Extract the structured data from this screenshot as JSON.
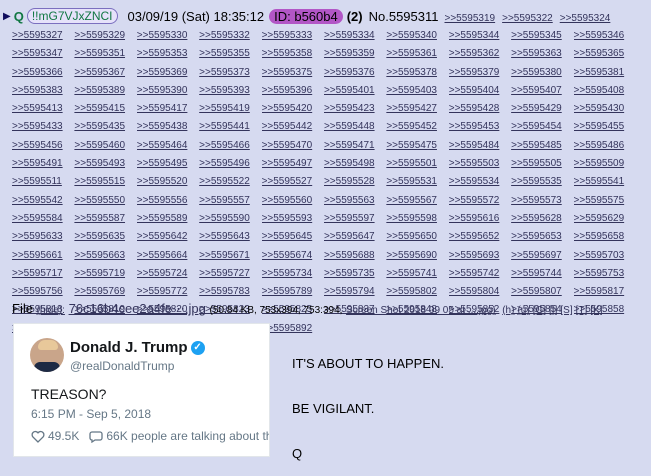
{
  "post": {
    "tripcode": "!!mG7VJxZNCI",
    "datetime": "03/09/19 (Sat) 18:35:12",
    "poster_id": "ID: b560b4",
    "post_count": "(2)",
    "post_number": "No.5595311",
    "header_replies": [
      ">>5595319",
      ">>5595322",
      ">>5595324"
    ],
    "replies": [
      ">>5595327",
      ">>5595329",
      ">>5595330",
      ">>5595332",
      ">>5595333",
      ">>5595334",
      ">>5595340",
      ">>5595344",
      ">>5595345",
      ">>5595346",
      ">>5595347",
      ">>5595351",
      ">>5595353",
      ">>5595355",
      ">>5595358",
      ">>5595359",
      ">>5595361",
      ">>5595362",
      ">>5595363",
      ">>5595365",
      ">>5595366",
      ">>5595367",
      ">>5595369",
      ">>5595373",
      ">>5595375",
      ">>5595376",
      ">>5595378",
      ">>5595379",
      ">>5595380",
      ">>5595381",
      ">>5595383",
      ">>5595389",
      ">>5595390",
      ">>5595393",
      ">>5595396",
      ">>5595401",
      ">>5595403",
      ">>5595404",
      ">>5595407",
      ">>5595408",
      ">>5595413",
      ">>5595415",
      ">>5595417",
      ">>5595419",
      ">>5595420",
      ">>5595423",
      ">>5595427",
      ">>5595428",
      ">>5595429",
      ">>5595430",
      ">>5595433",
      ">>5595435",
      ">>5595438",
      ">>5595441",
      ">>5595442",
      ">>5595448",
      ">>5595452",
      ">>5595453",
      ">>5595454",
      ">>5595455",
      ">>5595456",
      ">>5595460",
      ">>5595464",
      ">>5595466",
      ">>5595470",
      ">>5595471",
      ">>5595475",
      ">>5595484",
      ">>5595485",
      ">>5595486",
      ">>5595491",
      ">>5595493",
      ">>5595495",
      ">>5595496",
      ">>5595497",
      ">>5595498",
      ">>5595501",
      ">>5595503",
      ">>5595505",
      ">>5595509",
      ">>5595511",
      ">>5595515",
      ">>5595520",
      ">>5595522",
      ">>5595527",
      ">>5595528",
      ">>5595531",
      ">>5595534",
      ">>5595535",
      ">>5595541",
      ">>5595542",
      ">>5595550",
      ">>5595556",
      ">>5595557",
      ">>5595560",
      ">>5595563",
      ">>5595567",
      ">>5595572",
      ">>5595573",
      ">>5595575",
      ">>5595584",
      ">>5595587",
      ">>5595589",
      ">>5595590",
      ">>5595593",
      ">>5595597",
      ">>5595598",
      ">>5595616",
      ">>5595628",
      ">>5595629",
      ">>5595633",
      ">>5595635",
      ">>5595642",
      ">>5595643",
      ">>5595645",
      ">>5595647",
      ">>5595650",
      ">>5595652",
      ">>5595653",
      ">>5595658",
      ">>5595661",
      ">>5595663",
      ">>5595664",
      ">>5595671",
      ">>5595674",
      ">>5595688",
      ">>5595690",
      ">>5595693",
      ">>5595697",
      ">>5595703",
      ">>5595717",
      ">>5595719",
      ">>5595724",
      ">>5595727",
      ">>5595734",
      ">>5595735",
      ">>5595741",
      ">>5595742",
      ">>5595744",
      ">>5595753",
      ">>5595756",
      ">>5595769",
      ">>5595772",
      ">>5595783",
      ">>5595789",
      ">>5595794",
      ">>5595802",
      ">>5595804",
      ">>5595807",
      ">>5595817",
      ">>5595818",
      ">>5595819",
      ">>5595820",
      ">>5595823",
      ">>5595825",
      ">>5595837",
      ">>5595848",
      ">>5595852",
      ">>5595854",
      ">>5595858",
      ">>5595859",
      ">>5595860",
      ">>5595875",
      ">>5595876",
      ">>5595892"
    ],
    "file": {
      "label": "File",
      "hide": "(hide):",
      "filename": "76c16b4cee2a4fe⋯.jpg",
      "meta": "(50.84 KB, 753x394, 753:394,",
      "original_name": "Screen Shot 2018 09 05 at ....jpg)",
      "tools": [
        "(h)",
        "(u)",
        "[G]",
        "[I]",
        "[S]",
        "[T]",
        "[K]"
      ]
    },
    "tweet": {
      "name": "Donald J. Trump",
      "handle": "@realDonaldTrump",
      "text": "TREASON?",
      "time": "6:15 PM - Sep 5, 2018",
      "likes": "49.5K",
      "talking": "66K people are talking about th"
    },
    "message_lines": [
      "IT'S ABOUT TO HAPPEN.",
      "BE VIGILANT.",
      "Q"
    ]
  },
  "colors": {
    "background": "#d6daf0",
    "link": "#34345c",
    "name": "#117743",
    "poster_id_bg": "#b256c6"
  }
}
